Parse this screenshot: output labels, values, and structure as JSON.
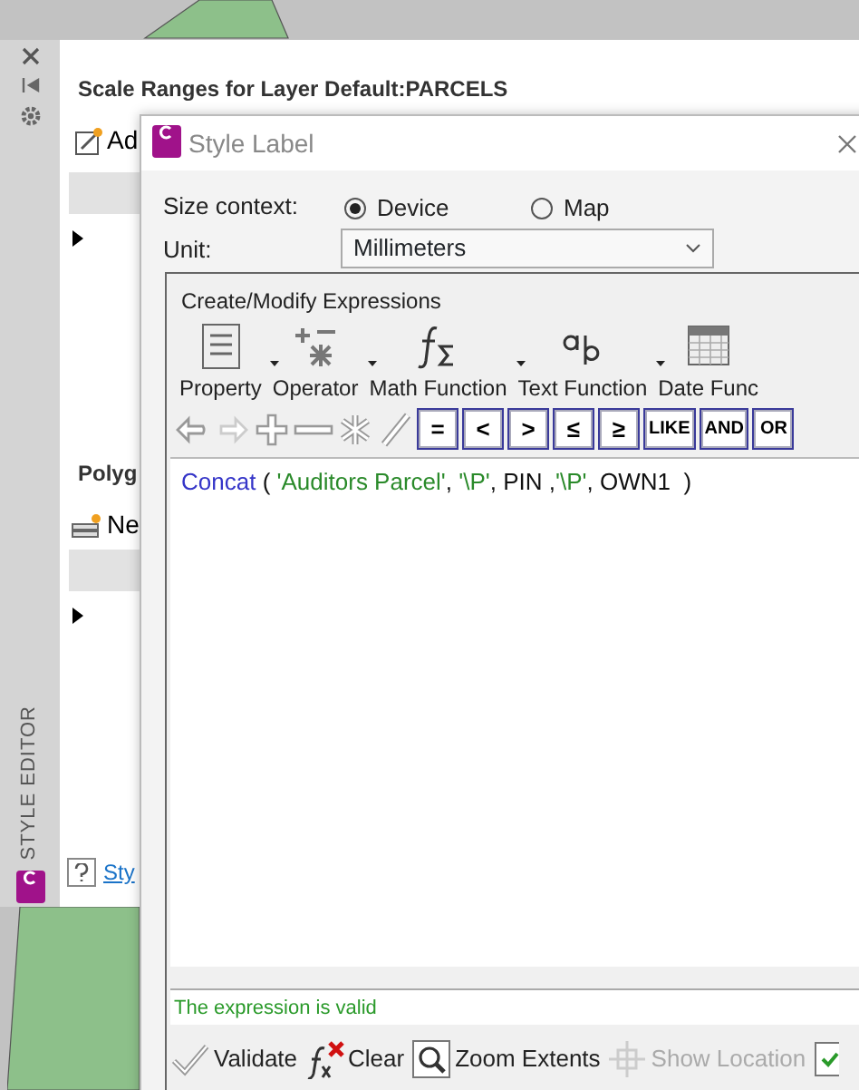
{
  "palette": {
    "title": "STYLE EDITOR"
  },
  "layer_panel": {
    "title": "Scale Ranges for Layer Default:PARCELS",
    "add_button": "Ad",
    "section_title": "Polyg",
    "new_button": "Ne",
    "help_link": "Sty"
  },
  "style_label": {
    "title": "Style Label",
    "size_context_label": "Size context:",
    "size_context": [
      {
        "label": "Device",
        "selected": true
      },
      {
        "label": "Map",
        "selected": false
      }
    ],
    "unit_label": "Unit:",
    "unit": "Millimeters"
  },
  "expression_editor": {
    "title": "Create/Modify Expressions",
    "categories": [
      {
        "label": "Property",
        "kind": "property"
      },
      {
        "label": "Operator",
        "kind": "operator"
      },
      {
        "label": "Math Function",
        "kind": "math"
      },
      {
        "label": "Text Function",
        "kind": "text"
      },
      {
        "label": "Date Func",
        "kind": "date"
      }
    ],
    "operators": [
      "=",
      "<",
      ">",
      "≤",
      "≥",
      "LIKE",
      "AND",
      "OR"
    ],
    "expression": [
      {
        "text": "Concat",
        "kind": "function"
      },
      {
        "text": " ( ",
        "kind": "plain"
      },
      {
        "text": "'Auditors Parcel'",
        "kind": "string"
      },
      {
        "text": ", ",
        "kind": "plain"
      },
      {
        "text": "'\\P'",
        "kind": "string"
      },
      {
        "text": ", PIN ,",
        "kind": "plain"
      },
      {
        "text": "'\\P'",
        "kind": "string"
      },
      {
        "text": ", OWN1  )",
        "kind": "plain"
      }
    ],
    "message": "The expression is valid",
    "actions": [
      {
        "label": "Validate",
        "kind": "validate",
        "disabled": false
      },
      {
        "label": "Clear",
        "kind": "clear",
        "disabled": false
      },
      {
        "label": "Zoom Extents",
        "kind": "zoom",
        "disabled": false
      },
      {
        "label": "Show Location",
        "kind": "location",
        "disabled": true
      }
    ]
  }
}
